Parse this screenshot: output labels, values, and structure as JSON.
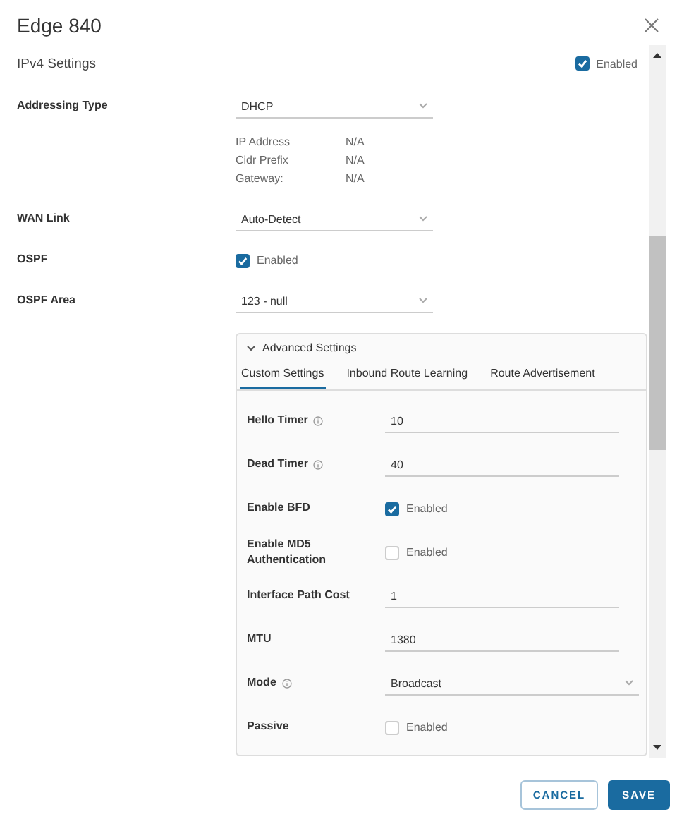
{
  "title": "Edge 840",
  "ipv4": {
    "label": "IPv4 Settings",
    "checkbox_label": "Enabled",
    "checked": true
  },
  "fields": [
    {
      "kind": "select",
      "label": "Addressing Type",
      "value": "DHCP"
    },
    {
      "kind": "info",
      "items": [
        {
          "label": "IP Address",
          "value": "N/A"
        },
        {
          "label": "Cidr Prefix",
          "value": "N/A"
        },
        {
          "label": "Gateway:",
          "value": "N/A"
        }
      ]
    },
    {
      "kind": "select",
      "label": "WAN Link",
      "value": "Auto-Detect"
    },
    {
      "kind": "checkbox",
      "label": "OSPF",
      "checkbox_label": "Enabled",
      "checked": true
    },
    {
      "kind": "select",
      "label": "OSPF Area",
      "value": "123 - null"
    }
  ],
  "advanced": {
    "title": "Advanced Settings",
    "expanded": true,
    "tabs": [
      {
        "label": "Custom Settings",
        "selected": true
      },
      {
        "label": "Inbound Route Learning",
        "selected": false
      },
      {
        "label": "Route Advertisement",
        "selected": false
      }
    ],
    "rows": [
      {
        "kind": "input",
        "label": "Hello Timer",
        "info": true,
        "value": "10"
      },
      {
        "kind": "input",
        "label": "Dead Timer",
        "info": true,
        "value": "40"
      },
      {
        "kind": "checkbox",
        "label": "Enable BFD",
        "info": false,
        "checkbox_label": "Enabled",
        "checked": true
      },
      {
        "kind": "checkbox",
        "label": "Enable MD5 Authentication",
        "info": false,
        "checkbox_label": "Enabled",
        "checked": false
      },
      {
        "kind": "input",
        "label": "Interface Path Cost",
        "info": false,
        "value": "1"
      },
      {
        "kind": "input",
        "label": "MTU",
        "info": false,
        "value": "1380"
      },
      {
        "kind": "select",
        "label": "Mode",
        "info": true,
        "value": "Broadcast"
      },
      {
        "kind": "checkbox",
        "label": "Passive",
        "info": false,
        "checkbox_label": "Enabled",
        "checked": false
      }
    ]
  },
  "buttons": [
    {
      "kind": "secondary",
      "label": "CANCEL"
    },
    {
      "kind": "primary",
      "label": "SAVE"
    }
  ]
}
